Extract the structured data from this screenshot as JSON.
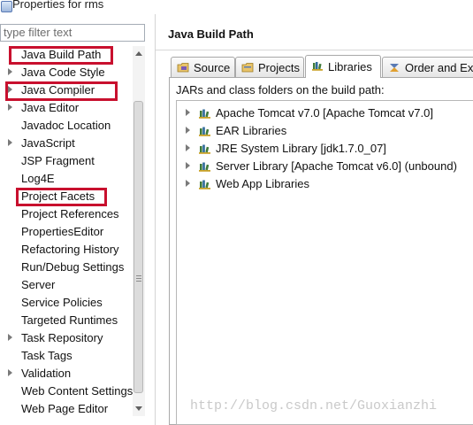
{
  "window": {
    "title": "Properties for rms"
  },
  "filter": {
    "placeholder": "type filter text",
    "value": ""
  },
  "tree": [
    {
      "label": "Java Build Path",
      "expandable": false,
      "highlighted": true,
      "selected": true
    },
    {
      "label": "Java Code Style",
      "expandable": true,
      "highlighted": false
    },
    {
      "label": "Java Compiler",
      "expandable": true,
      "highlighted": true
    },
    {
      "label": "Java Editor",
      "expandable": true,
      "highlighted": false
    },
    {
      "label": "Javadoc Location",
      "expandable": false,
      "highlighted": false
    },
    {
      "label": "JavaScript",
      "expandable": true,
      "highlighted": false
    },
    {
      "label": "JSP Fragment",
      "expandable": false,
      "highlighted": false
    },
    {
      "label": "Log4E",
      "expandable": false,
      "highlighted": false
    },
    {
      "label": "Project Facets",
      "expandable": false,
      "highlighted": true
    },
    {
      "label": "Project References",
      "expandable": false,
      "highlighted": false
    },
    {
      "label": "PropertiesEditor",
      "expandable": false,
      "highlighted": false
    },
    {
      "label": "Refactoring History",
      "expandable": false,
      "highlighted": false
    },
    {
      "label": "Run/Debug Settings",
      "expandable": false,
      "highlighted": false
    },
    {
      "label": "Server",
      "expandable": false,
      "highlighted": false
    },
    {
      "label": "Service Policies",
      "expandable": false,
      "highlighted": false
    },
    {
      "label": "Targeted Runtimes",
      "expandable": false,
      "highlighted": false
    },
    {
      "label": "Task Repository",
      "expandable": true,
      "highlighted": false
    },
    {
      "label": "Task Tags",
      "expandable": false,
      "highlighted": false
    },
    {
      "label": "Validation",
      "expandable": true,
      "highlighted": false
    },
    {
      "label": "Web Content Settings",
      "expandable": false,
      "highlighted": false
    },
    {
      "label": "Web Page Editor",
      "expandable": false,
      "highlighted": false
    }
  ],
  "page": {
    "title": "Java Build Path",
    "tabs": [
      {
        "label": "Source",
        "icon": "source-folder-icon",
        "active": false
      },
      {
        "label": "Projects",
        "icon": "projects-icon",
        "active": false
      },
      {
        "label": "Libraries",
        "icon": "libraries-icon",
        "active": true
      },
      {
        "label": "Order and Ex",
        "icon": "order-export-icon",
        "active": false
      }
    ],
    "libraries_label": "JARs and class folders on the build path:",
    "libraries": [
      {
        "label": "Apache Tomcat v7.0 [Apache Tomcat v7.0]",
        "icon": "library-icon"
      },
      {
        "label": "EAR Libraries",
        "icon": "library-icon"
      },
      {
        "label": "JRE System Library [jdk1.7.0_07]",
        "icon": "library-icon"
      },
      {
        "label": "Server Library [Apache Tomcat v6.0] (unbound)",
        "icon": "library-icon"
      },
      {
        "label": "Web App Libraries",
        "icon": "library-icon"
      }
    ]
  },
  "watermark": "http://blog.csdn.net/Guoxianzhi",
  "colors": {
    "highlight_box": "#c8102e",
    "library_icon_books": "#3f7a3a",
    "library_icon_shelf": "#c9a227"
  }
}
